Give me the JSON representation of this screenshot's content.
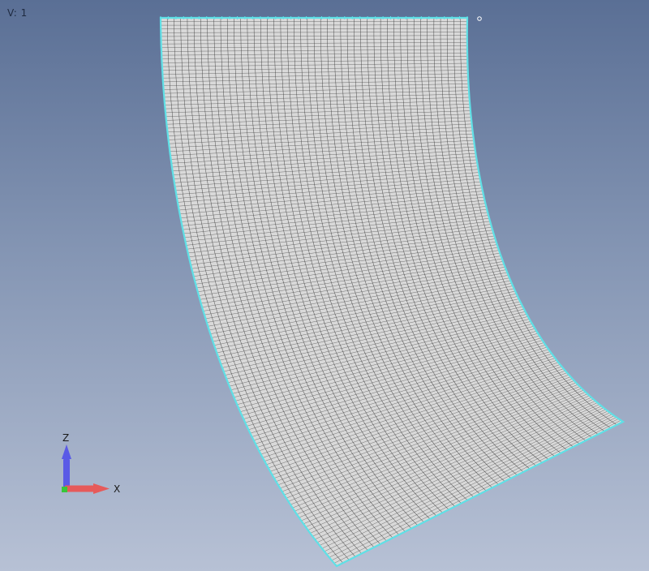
{
  "viewport": {
    "view_label": "V: 1"
  },
  "triad": {
    "z_label": "Z",
    "x_label": "X",
    "z_color": "#5a5ae6",
    "x_color": "#e65a5a",
    "origin_color": "#39c639"
  },
  "surface": {
    "edge_color": "#5fe0e6",
    "mesh_color": "#3a3a3a",
    "fill_color": "#d9d9d9"
  }
}
